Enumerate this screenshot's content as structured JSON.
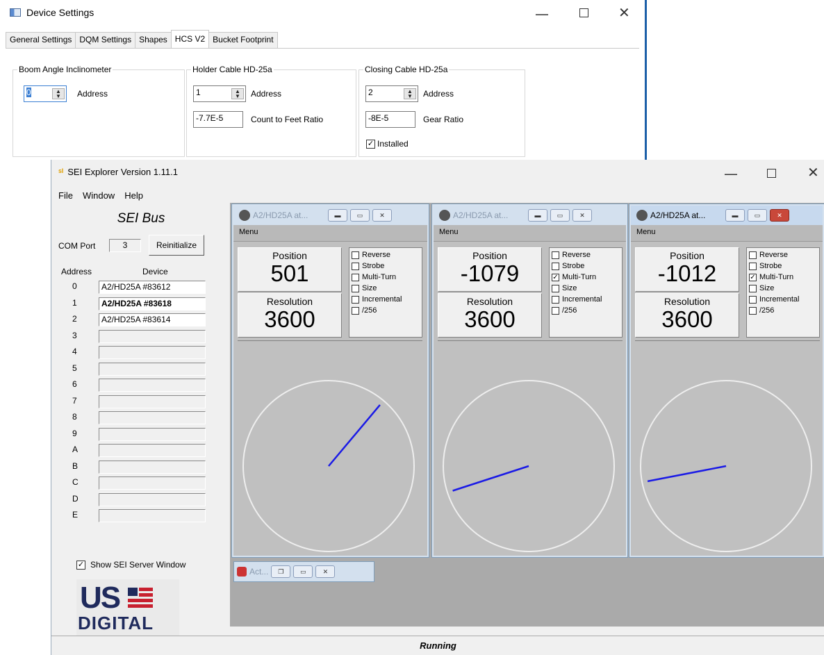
{
  "device_settings": {
    "title": "Device Settings",
    "tabs": [
      "General Settings",
      "DQM Settings",
      "Shapes",
      "HCS V2",
      "Bucket Footprint"
    ],
    "active_tab": "HCS V2",
    "groups": {
      "boom": {
        "label": "Boom Angle Inclinometer",
        "address_value": "0",
        "address_label": "Address"
      },
      "holder": {
        "label": "Holder Cable HD-25a",
        "address_value": "1",
        "address_label": "Address",
        "ratio_value": "-7.7E-5",
        "ratio_label": "Count to Feet Ratio"
      },
      "closing": {
        "label": "Closing Cable HD-25a",
        "address_value": "2",
        "address_label": "Address",
        "ratio_value": "-8E-5",
        "ratio_label": "Gear Ratio",
        "installed_label": "Installed",
        "installed_checked": true
      }
    }
  },
  "sei": {
    "title": "SEI Explorer Version 1.11.1",
    "menu": [
      "File",
      "Window",
      "Help"
    ],
    "bus": {
      "heading": "SEI Bus",
      "com_label": "COM Port",
      "com_value": "3",
      "reinit_label": "Reinitialize",
      "address_header": "Address",
      "device_header": "Device",
      "rows": [
        {
          "addr": "0",
          "device": "A2/HD25A #83612",
          "bold": false
        },
        {
          "addr": "1",
          "device": "A2/HD25A #83618",
          "bold": true
        },
        {
          "addr": "2",
          "device": "A2/HD25A #83614",
          "bold": false
        },
        {
          "addr": "3",
          "device": ""
        },
        {
          "addr": "4",
          "device": ""
        },
        {
          "addr": "5",
          "device": ""
        },
        {
          "addr": "6",
          "device": ""
        },
        {
          "addr": "7",
          "device": ""
        },
        {
          "addr": "8",
          "device": ""
        },
        {
          "addr": "9",
          "device": ""
        },
        {
          "addr": "A",
          "device": ""
        },
        {
          "addr": "B",
          "device": ""
        },
        {
          "addr": "C",
          "device": ""
        },
        {
          "addr": "D",
          "device": ""
        },
        {
          "addr": "E",
          "device": ""
        }
      ],
      "show_server_label": "Show SEI Server Window",
      "show_server_checked": true,
      "logo_top": "US",
      "logo_bottom": "DIGITAL"
    },
    "encoders": [
      {
        "title": "A2/HD25A at...",
        "menu": "Menu",
        "position_label": "Position",
        "position": "501",
        "resolution_label": "Resolution",
        "resolution": "3600",
        "options": [
          {
            "label": "Reverse",
            "checked": false
          },
          {
            "label": "Strobe",
            "checked": false
          },
          {
            "label": "Multi-Turn",
            "checked": false
          },
          {
            "label": "Size",
            "checked": false
          },
          {
            "label": "Incremental",
            "checked": false
          },
          {
            "label": "/256",
            "checked": false
          }
        ],
        "needle_angle_deg": 50,
        "active": false
      },
      {
        "title": "A2/HD25A at...",
        "menu": "Menu",
        "position_label": "Position",
        "position": "-1079",
        "resolution_label": "Resolution",
        "resolution": "3600",
        "options": [
          {
            "label": "Reverse",
            "checked": false
          },
          {
            "label": "Strobe",
            "checked": false
          },
          {
            "label": "Multi-Turn",
            "checked": true
          },
          {
            "label": "Size",
            "checked": false
          },
          {
            "label": "Incremental",
            "checked": false
          },
          {
            "label": "/256",
            "checked": false
          }
        ],
        "needle_angle_deg": 198,
        "active": false
      },
      {
        "title": "A2/HD25A at...",
        "menu": "Menu",
        "position_label": "Position",
        "position": "-1012",
        "resolution_label": "Resolution",
        "resolution": "3600",
        "options": [
          {
            "label": "Reverse",
            "checked": false
          },
          {
            "label": "Strobe",
            "checked": false
          },
          {
            "label": "Multi-Turn",
            "checked": true
          },
          {
            "label": "Size",
            "checked": false
          },
          {
            "label": "Incremental",
            "checked": false
          },
          {
            "label": "/256",
            "checked": false
          }
        ],
        "needle_angle_deg": 191,
        "active": true
      }
    ],
    "minimized_child": "Act...",
    "status": "Running"
  }
}
